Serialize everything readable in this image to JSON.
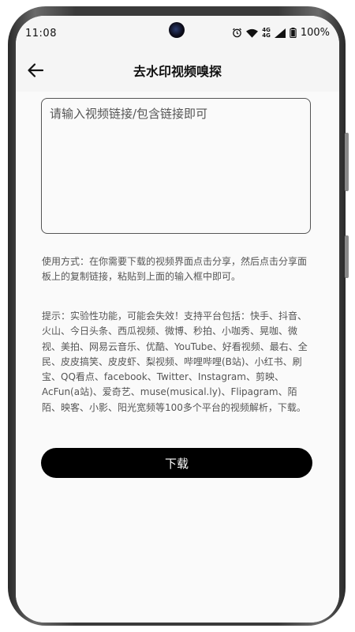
{
  "status_bar": {
    "time": "11:08",
    "battery": "100%",
    "network_top": "4G",
    "network_bottom": "4G"
  },
  "app_bar": {
    "title": "去水印视频嗅探"
  },
  "input": {
    "placeholder": "请输入视频链接/包含链接即可",
    "value": ""
  },
  "usage": {
    "text": "使用方式：在你需要下载的视频界面点击分享，然后点击分享面板上的复制链接，粘贴到上面的输入框中即可。"
  },
  "tips": {
    "text": "提示：实验性功能，可能会失效！支持平台包括：快手、抖音、火山、今日头条、西瓜视频、微博、秒拍、小咖秀、晃咖、微视、美拍、网易云音乐、优酷、YouTube、好看视频、最右、全民、皮皮搞笑、皮皮虾、梨视频、哔哩哔哩(B站)、小红书、刷宝、QQ看点、facebook、Twitter、Instagram、剪映、AcFun(a站)、爱奇艺、muse(musical.ly)、Flipagram、陌陌、映客、小影、阳光宽频等100多个平台的视频解析，下载。"
  },
  "actions": {
    "download_label": "下载"
  },
  "colors": {
    "button_bg": "#000000",
    "button_text": "#ffffff",
    "page_bg": "#fafafa"
  }
}
